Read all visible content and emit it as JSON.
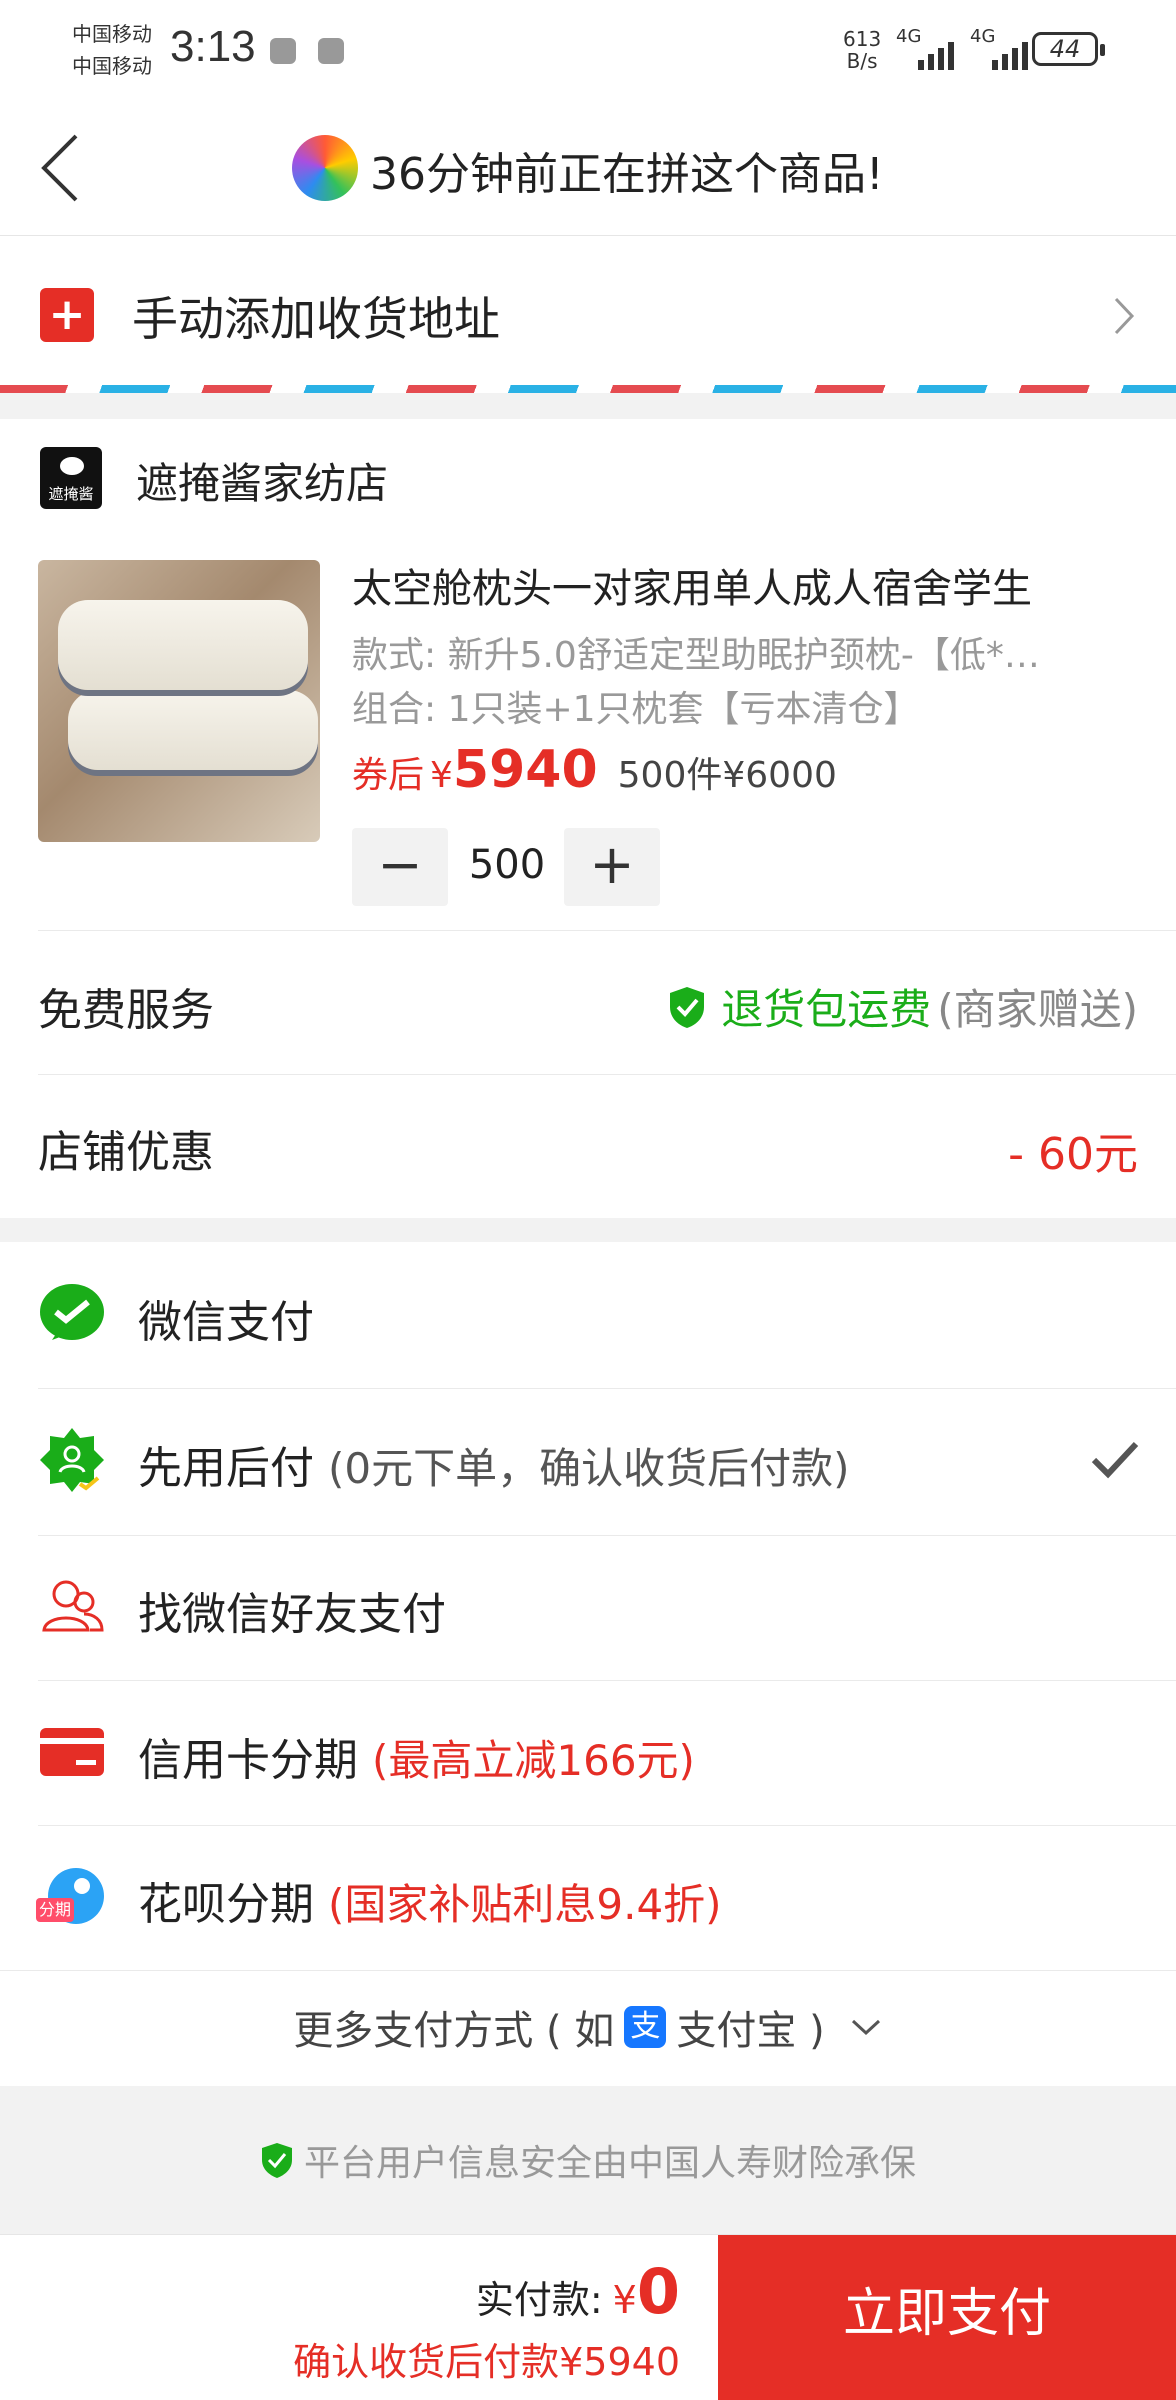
{
  "status_bar": {
    "carrier_1": "中国移动",
    "carrier_2": "中国移动",
    "time": "3:13",
    "net_speed_value": "613",
    "net_speed_unit": "B/s",
    "network_1": "4G",
    "network_2": "4G",
    "battery": "44"
  },
  "header": {
    "title": "36分钟前正在拼这个商品!"
  },
  "address": {
    "label": "手动添加收货地址"
  },
  "shop": {
    "logo_text": "遮掩酱",
    "name": "遮掩酱家纺店"
  },
  "product": {
    "title": "太空舱枕头一对家用单人成人宿舍学生",
    "spec_style": "款式: 新升5.0舒适定型助眠护颈枕-【低*…",
    "spec_combo": "组合: 1只装+1只枕套【亏本清仓】",
    "coupon_label": "券后",
    "currency": "¥",
    "price": "5940",
    "original_price": "500件¥6000",
    "quantity": "500",
    "minus": "−",
    "plus": "+"
  },
  "services": {
    "free_label": "免费服务",
    "free_value": "退货包运费",
    "free_note": "(商家赠送)",
    "shop_discount_label": "店铺优惠",
    "shop_discount_value": "- 60元"
  },
  "payment": {
    "options": [
      {
        "label": "微信支付",
        "note": ""
      },
      {
        "label": "先用后付",
        "note": "(0元下单，确认收货后付款)"
      },
      {
        "label": "找微信好友支付",
        "note": ""
      },
      {
        "label": "信用卡分期",
        "note": "(最高立减166元)"
      },
      {
        "label": "花呗分期",
        "note": "(国家补贴利息9.4折)"
      }
    ],
    "huabei_badge": "分期",
    "more_prefix": "更多支付方式 ( 如",
    "alipay_glyph": "支",
    "more_suffix": "支付宝 )"
  },
  "security_note": "平台用户信息安全由中国人寿财险承保",
  "footer": {
    "paid_label": "实付款:",
    "currency": "¥",
    "paid_value": "0",
    "note": "确认收货后付款¥5940",
    "pay_button": "立即支付"
  },
  "colors": {
    "brand_red": "#e52e26",
    "wechat_green": "#1aad19",
    "alipay_blue": "#1677ff"
  }
}
